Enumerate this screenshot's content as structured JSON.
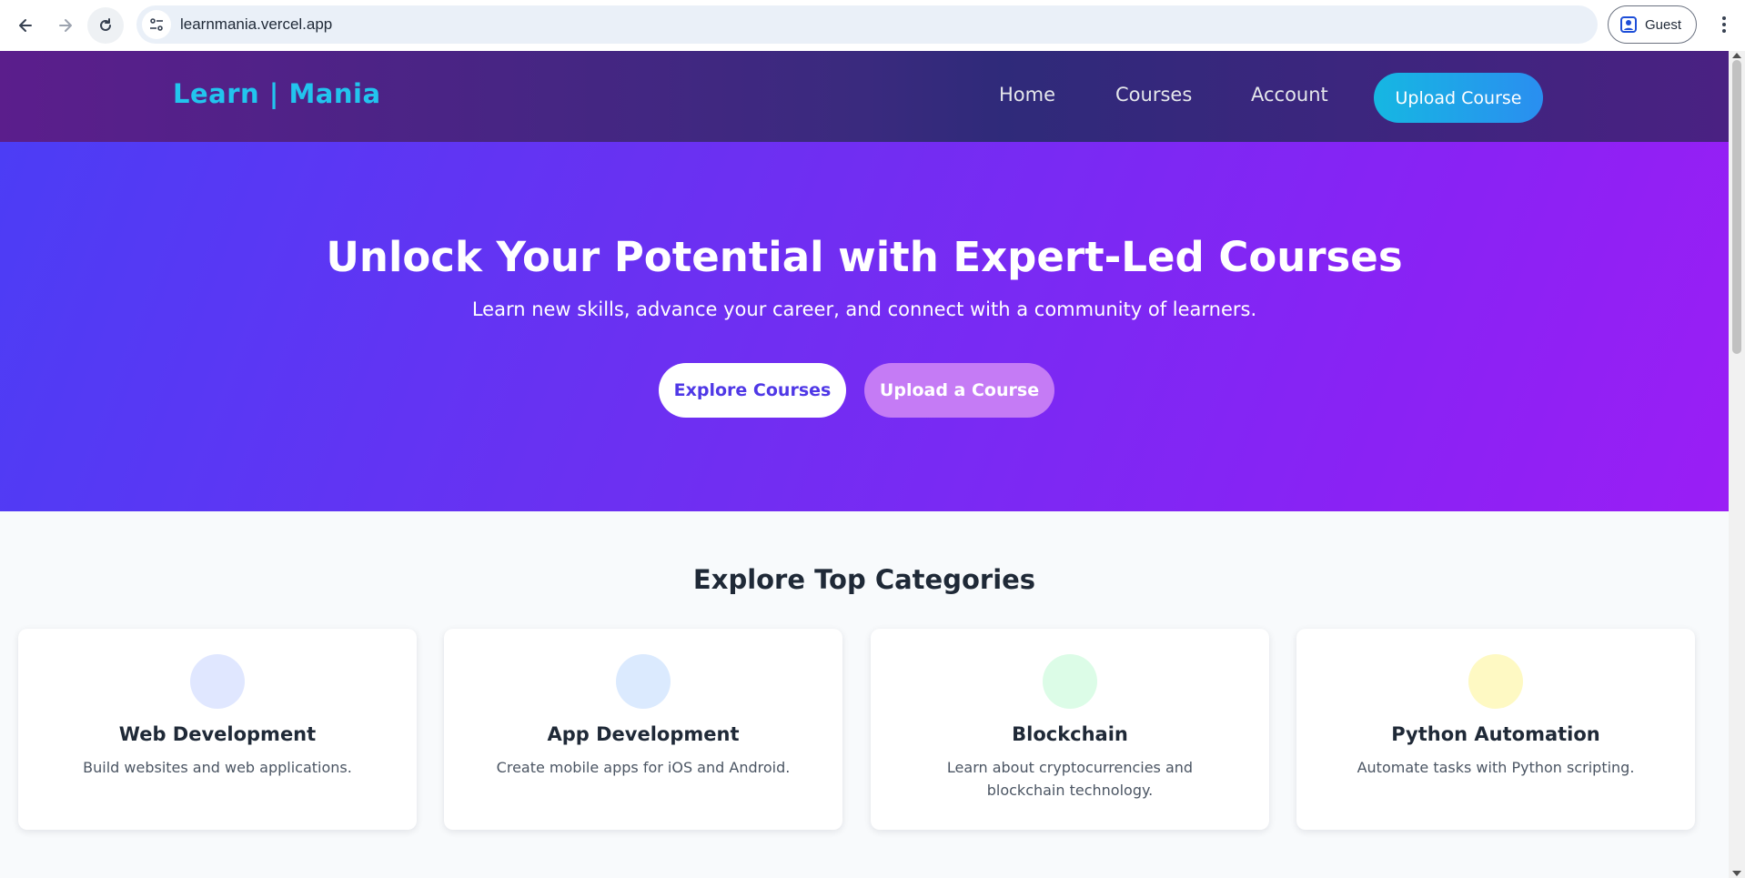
{
  "browser": {
    "url": "learnmania.vercel.app",
    "profile_label": "Guest",
    "icons": [
      "back-arrow-icon",
      "forward-arrow-icon",
      "reload-icon",
      "site-settings-icon",
      "profile-icon",
      "more-menu-icon"
    ]
  },
  "header": {
    "logo": "Learn | Mania",
    "nav": {
      "home": "Home",
      "courses": "Courses",
      "account": "Account"
    },
    "upload_button": "Upload Course"
  },
  "hero": {
    "title": "Unlock Your Potential with Expert-Led Courses",
    "subtitle": "Learn new skills, advance your career, and connect with a community of learners.",
    "explore_button": "Explore Courses",
    "upload_button": "Upload a Course"
  },
  "categories": {
    "title": "Explore Top Categories",
    "items": [
      {
        "name": "Web Development",
        "description": "Build websites and web applications.",
        "color": "#e0e7ff"
      },
      {
        "name": "App Development",
        "description": "Create mobile apps for iOS and Android.",
        "color": "#dbeafe"
      },
      {
        "name": "Blockchain",
        "description": "Learn about cryptocurrencies and blockchain technology.",
        "color": "#dcfce7"
      },
      {
        "name": "Python Automation",
        "description": "Automate tasks with Python scripting.",
        "color": "#fef9c3"
      }
    ]
  },
  "colors": {
    "logo": "#22c4ee",
    "hero_start": "#4c3df5",
    "hero_end": "#9a1ef5",
    "upload_start": "#16b7e2",
    "upload_end": "#2a8ef0"
  }
}
